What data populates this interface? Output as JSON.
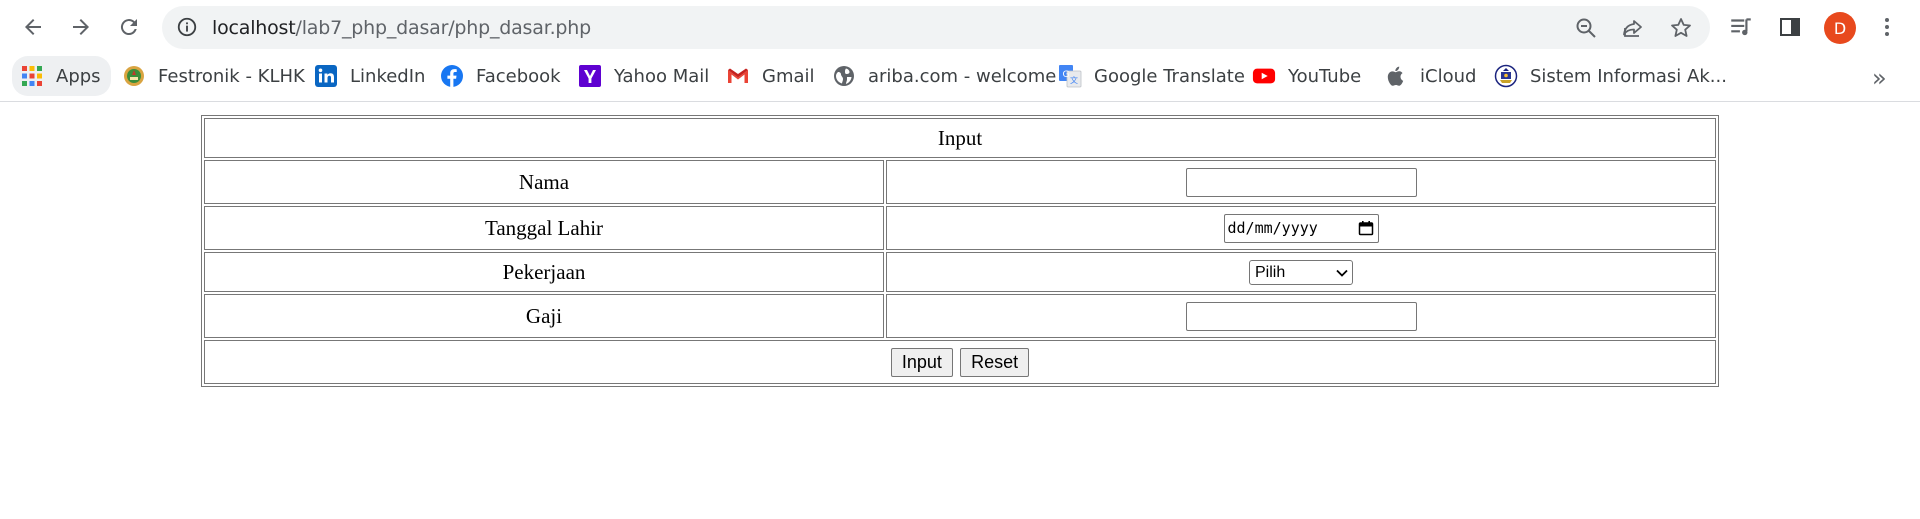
{
  "browser": {
    "url_host": "localhost",
    "url_path": "/lab7_php_dasar/php_dasar.php",
    "profile_initial": "D",
    "icons": {
      "back": "back-arrow-icon",
      "forward": "forward-arrow-icon",
      "reload": "reload-icon",
      "site_info": "info-icon",
      "zoom": "zoom-out-icon",
      "share": "share-icon",
      "bookmark": "star-icon",
      "media": "media-queue-icon",
      "side_panel": "side-panel-icon",
      "menu": "kebab-menu-icon"
    },
    "colors": {
      "avatar": "#e8491d",
      "omnibox": "#f1f3f4"
    }
  },
  "bookmarks": {
    "items": [
      {
        "label": "Apps",
        "icon": "apps-grid-icon"
      },
      {
        "label": "Festronik - KLHK",
        "icon": "klhk-logo-icon"
      },
      {
        "label": "LinkedIn",
        "icon": "linkedin-icon"
      },
      {
        "label": "Facebook",
        "icon": "facebook-icon"
      },
      {
        "label": "Yahoo Mail",
        "icon": "yahoo-icon"
      },
      {
        "label": "Gmail",
        "icon": "gmail-icon"
      },
      {
        "label": "ariba.com - welcome",
        "icon": "globe-icon"
      },
      {
        "label": "Google Translate",
        "icon": "google-translate-icon"
      },
      {
        "label": "YouTube",
        "icon": "youtube-icon"
      },
      {
        "label": "iCloud",
        "icon": "apple-icon"
      },
      {
        "label": "Sistem Informasi Ak...",
        "icon": "university-seal-icon"
      }
    ],
    "more": "»"
  },
  "form": {
    "header": "Input",
    "fields": [
      {
        "label": "Nama",
        "type": "text",
        "value": ""
      },
      {
        "label": "Tanggal Lahir",
        "type": "date",
        "placeholder": "dd/mm/yyyy"
      },
      {
        "label": "Pekerjaan",
        "type": "select",
        "selected": "Pilih"
      },
      {
        "label": "Gaji",
        "type": "text",
        "value": ""
      }
    ],
    "submit_label": "Input",
    "reset_label": "Reset"
  }
}
